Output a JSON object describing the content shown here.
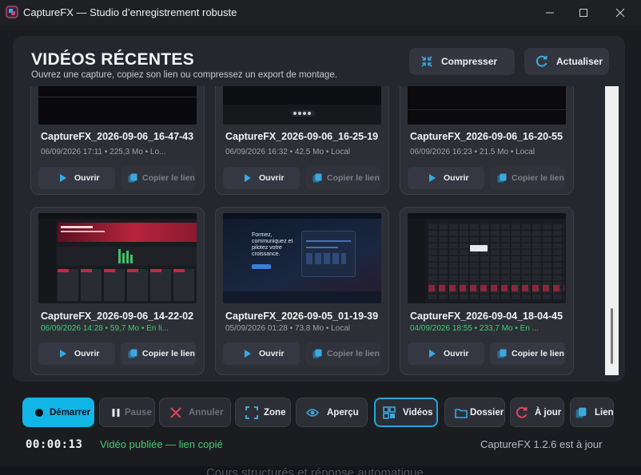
{
  "window": {
    "title": "CaptureFX — Studio d’enregistrement robuste",
    "controls": [
      "minimize",
      "maximize",
      "close"
    ]
  },
  "header": {
    "title": "VIDÉOS RÉCENTES",
    "subtitle": "Ouvrez une capture, copiez son lien ou compressez un export de montage.",
    "compress_label": "Compresser",
    "refresh_label": "Actualiser"
  },
  "videos": [
    {
      "name": "CaptureFX_2026-09-06_16-47-43",
      "meta": "06/09/2026 17:11  •  225,3 Mo  •  Lo...",
      "published": false,
      "open_label": "Ouvrir",
      "copy_label": "Copier le lien",
      "copy_enabled": false
    },
    {
      "name": "CaptureFX_2026-09-06_16-25-19",
      "meta": "06/09/2026 16:32  •  42.5 Mo  •  Local",
      "published": false,
      "open_label": "Ouvrir",
      "copy_label": "Copier le lien",
      "copy_enabled": false
    },
    {
      "name": "CaptureFX_2026-09-06_16-20-55",
      "meta": "06/09/2026 16:23  •  21.5 Mo  •  Local",
      "published": false,
      "open_label": "Ouvrir",
      "copy_label": "Copier le lien",
      "copy_enabled": false
    },
    {
      "name": "CaptureFX_2026-09-06_14-22-02",
      "meta": "06/09/2026 14:28  •  59,7 Mo  •  En li...",
      "published": true,
      "open_label": "Ouvrir",
      "copy_label": "Copier le lien",
      "copy_enabled": true
    },
    {
      "name": "CaptureFX_2026-09-05_01-19-39",
      "meta": "05/09/2026 01:28  •  73.8 Mo  •  Local",
      "published": false,
      "open_label": "Ouvrir",
      "copy_label": "Copier le lien",
      "copy_enabled": false
    },
    {
      "name": "CaptureFX_2026-09-04_18-04-45",
      "meta": "04/09/2026 18:55  •  233,7 Mo  •  En ...",
      "published": true,
      "open_label": "Ouvrir",
      "copy_label": "Copier le lien",
      "copy_enabled": true
    }
  ],
  "thumb_text": {
    "headline": "Formez, communiquez et pilotez votre croissance."
  },
  "toolbar": {
    "start": "Démarrer",
    "pause": "Pause",
    "cancel": "Annuler",
    "zone": "Zone",
    "preview": "Aperçu",
    "videos": "Vidéos",
    "folder": "Dossier",
    "update": "À jour",
    "link": "Lien"
  },
  "status": {
    "timer": "00:00:13",
    "message": "Vidéo publiée — lien copié",
    "version": "CaptureFX 1.2.6 est à jour"
  },
  "colors": {
    "accent": "#12b6e6",
    "success": "#3fcf72",
    "danger": "#e0445a",
    "panel": "#25272e"
  },
  "background": {
    "text": "Cours structurés et réponse automatique"
  }
}
